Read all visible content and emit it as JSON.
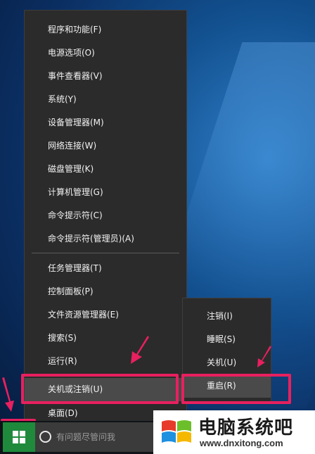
{
  "context_menu": {
    "items": [
      {
        "label": "程序和功能(F)"
      },
      {
        "label": "电源选项(O)"
      },
      {
        "label": "事件查看器(V)"
      },
      {
        "label": "系统(Y)"
      },
      {
        "label": "设备管理器(M)"
      },
      {
        "label": "网络连接(W)"
      },
      {
        "label": "磁盘管理(K)"
      },
      {
        "label": "计算机管理(G)"
      },
      {
        "label": "命令提示符(C)"
      },
      {
        "label": "命令提示符(管理员)(A)"
      },
      {
        "label": "任务管理器(T)"
      },
      {
        "label": "控制面板(P)"
      },
      {
        "label": "文件资源管理器(E)"
      },
      {
        "label": "搜索(S)"
      },
      {
        "label": "运行(R)"
      },
      {
        "label": "关机或注销(U)"
      },
      {
        "label": "桌面(D)"
      }
    ]
  },
  "shutdown_submenu": {
    "items": [
      {
        "label": "注销(I)"
      },
      {
        "label": "睡眠(S)"
      },
      {
        "label": "关机(U)"
      },
      {
        "label": "重启(R)"
      }
    ]
  },
  "taskbar": {
    "search_placeholder": "有问题尽管问我"
  },
  "watermark": {
    "title": "电脑系统吧",
    "url": "www.dnxitong.com"
  },
  "colors": {
    "highlight": "#e8205f",
    "start_button": "#1f8a3c",
    "menu_bg": "#2b2b2b"
  }
}
